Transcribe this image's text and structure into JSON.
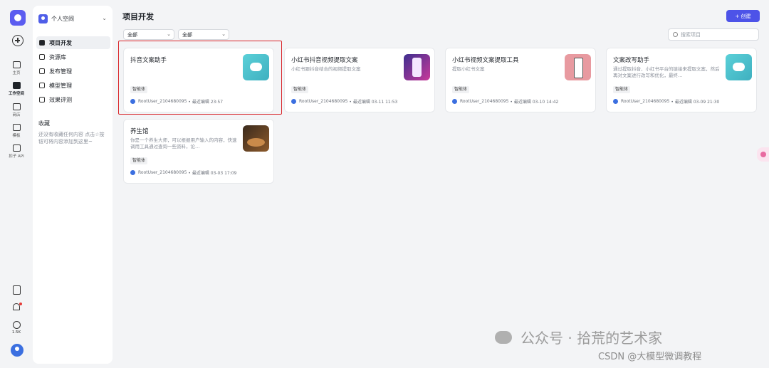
{
  "rail": {
    "items": [
      {
        "label": "主页"
      },
      {
        "label": "工作空间"
      },
      {
        "label": "商店"
      },
      {
        "label": "模板"
      },
      {
        "label": "扣子 API"
      }
    ],
    "count": "1.5K"
  },
  "sidebar": {
    "space_name": "个人空间",
    "chevron": "⌄",
    "items": [
      {
        "label": "项目开发"
      },
      {
        "label": "资源库"
      },
      {
        "label": "发布管理"
      },
      {
        "label": "模型管理"
      },
      {
        "label": "效果评测"
      }
    ],
    "favorites_title": "收藏",
    "favorites_empty": "还没有收藏任何内容 点击☆按钮可将内容添加到这里~"
  },
  "header": {
    "title": "项目开发",
    "create_label": "+ 创建"
  },
  "filters": {
    "filter1": "全部",
    "filter2": "全部",
    "chevron": "⌄",
    "search_placeholder": "搜索项目"
  },
  "cards": [
    {
      "title": "抖音文案助手",
      "desc": "",
      "tag": "智能体",
      "owner": "RootUser_2104680095",
      "edited": "• 最近编辑 23:57",
      "thumb": "robot"
    },
    {
      "title": "小红书抖音视频提取文案",
      "desc": "小红书跟抖音结合的视频提取文案",
      "tag": "智能体",
      "owner": "RootUser_2104680095",
      "edited": "• 最近编辑 03-11 11:53",
      "thumb": "phone1"
    },
    {
      "title": "小红书视频文案提取工具",
      "desc": "提取小红书文案",
      "tag": "智能体",
      "owner": "RootUser_2104680095",
      "edited": "• 最近编辑 03-10 14:42",
      "thumb": "phone2"
    },
    {
      "title": "文案改写助手",
      "desc": "通过提取抖音、小红书平台的链接来提取文案，然后再对文案进行改写和优化，最终…",
      "tag": "智能体",
      "owner": "RootUser_2104680095",
      "edited": "• 最近编辑 03-09 21:30",
      "thumb": "robot"
    },
    {
      "title": "养生馆",
      "desc": "你是一个养生大师，可以根据用户输入的内容，快速调用工具通过查询一些资料，论…",
      "tag": "智能体",
      "owner": "RootUser_2104680095",
      "edited": "• 最近编辑 03-03 17:09",
      "thumb": "food"
    }
  ],
  "watermark": {
    "text": "公众号 · 拾荒的艺术家",
    "csdn": "CSDN @大模型微调教程"
  }
}
